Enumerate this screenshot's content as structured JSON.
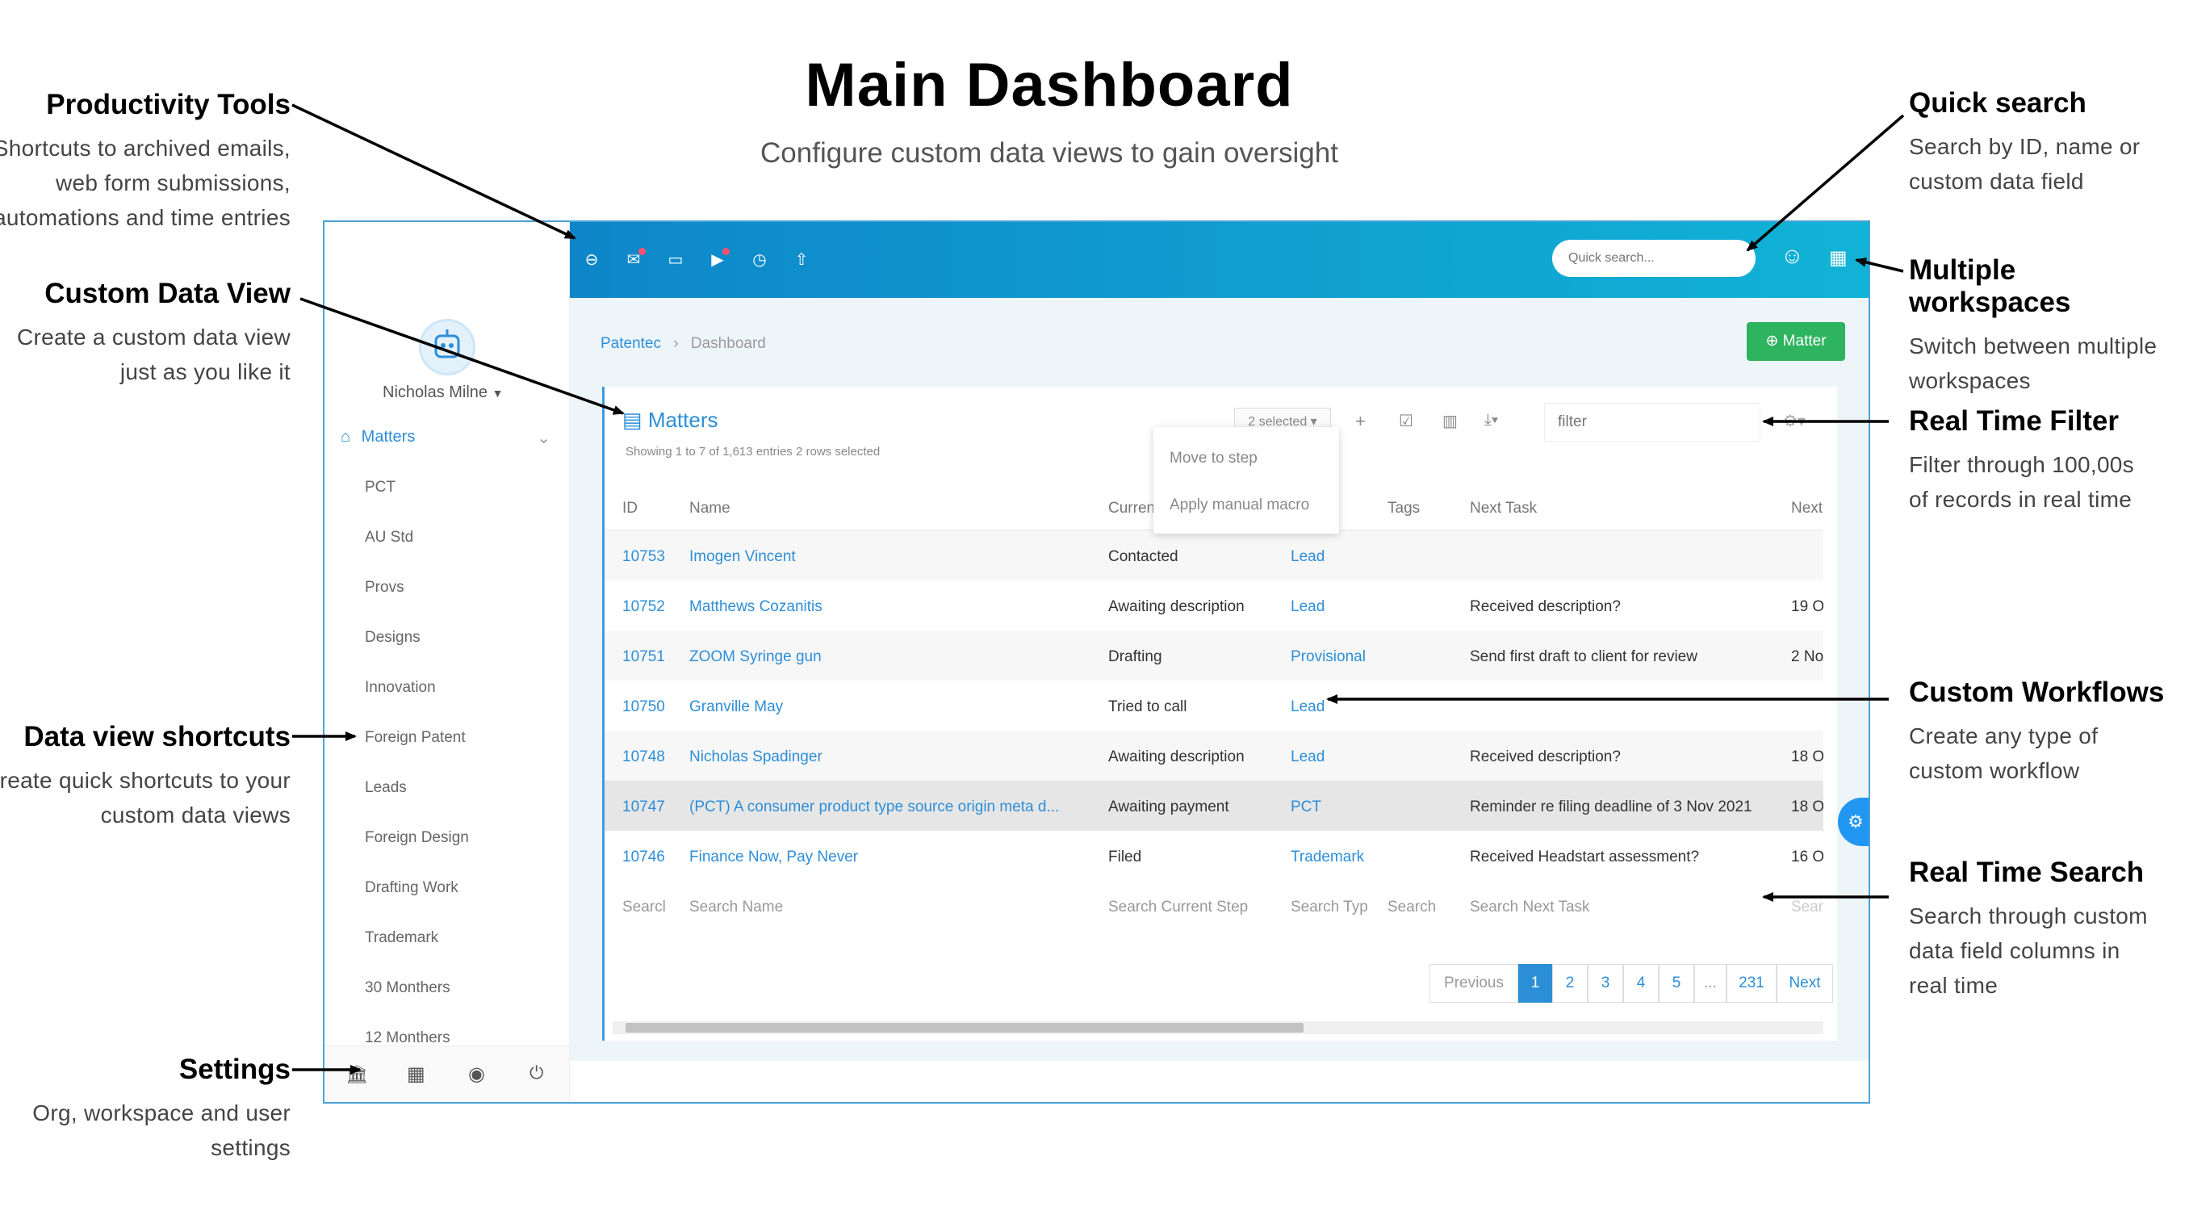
{
  "header": {
    "title": "Main Dashboard",
    "subtitle": "Configure custom data views to gain oversight"
  },
  "annotations": {
    "productivity": {
      "title": "Productivity Tools",
      "lines": [
        "Shortcuts to archived emails,",
        "web form submissions,",
        "automations and time entries"
      ]
    },
    "custom_view": {
      "title": "Custom Data View",
      "lines": [
        "Create a custom data view",
        "just as you like it"
      ]
    },
    "shortcuts": {
      "title": "Data view shortcuts",
      "lines": [
        "Create quick shortcuts to your",
        "custom data views"
      ]
    },
    "settings": {
      "title": "Settings",
      "lines": [
        "Org, workspace and user",
        "settings"
      ]
    },
    "quick_search": {
      "title": "Quick search",
      "lines": [
        "Search by ID, name or",
        "custom data field"
      ]
    },
    "workspaces": {
      "title": "Multiple workspaces",
      "lines": [
        "Switch between multiple",
        "workspaces"
      ]
    },
    "filter": {
      "title": "Real Time Filter",
      "lines": [
        "Filter through 100,00s",
        "of records in real time"
      ]
    },
    "workflows": {
      "title": "Custom Workflows",
      "lines": [
        "Create any type of",
        "custom workflow"
      ]
    },
    "search": {
      "title": "Real Time Search",
      "lines": [
        "Search through custom",
        "data field columns in",
        "real time"
      ]
    }
  },
  "app": {
    "quick_search_placeholder": "Quick search...",
    "user_name": "Nicholas Milne",
    "nav_active": "Matters",
    "nav_items": [
      "PCT",
      "AU Std",
      "Provs",
      "Designs",
      "Innovation",
      "Foreign Patent",
      "Leads",
      "Foreign Design",
      "Drafting Work",
      "Trademark",
      "30 Monthers",
      "12 Monthers"
    ],
    "breadcrumb": [
      "Patentec",
      "Dashboard"
    ],
    "new_matter_button": "Matter",
    "panel_title": "Matters",
    "panel_info": "Showing 1 to 7 of 1,613 entries  2 rows selected",
    "selected_dropdown": "2 selected",
    "filter_placeholder": "filter",
    "dropdown_menu": [
      "Move to step",
      "Apply manual macro"
    ],
    "columns": [
      "ID",
      "Name",
      "Curren",
      "Tags",
      "Next Task",
      "Next"
    ],
    "rows": [
      {
        "id": "10753",
        "name": "Imogen Vincent",
        "step": "Contacted",
        "type": "Lead",
        "task": "",
        "next": ""
      },
      {
        "id": "10752",
        "name": "Matthews Cozanitis",
        "step": "Awaiting description",
        "type": "Lead",
        "task": "Received description?",
        "next": "19 O"
      },
      {
        "id": "10751",
        "name": "ZOOM Syringe gun",
        "step": "Drafting",
        "type": "Provisional",
        "task": "Send first draft to client for review",
        "next": "2 Nov"
      },
      {
        "id": "10750",
        "name": "Granville May",
        "step": "Tried to call",
        "type": "Lead",
        "task": "",
        "next": ""
      },
      {
        "id": "10748",
        "name": "Nicholas Spadinger",
        "step": "Awaiting description",
        "type": "Lead",
        "task": "Received description?",
        "next": "18 Oc"
      },
      {
        "id": "10747",
        "name": "(PCT) A consumer product type source origin meta d...",
        "step": "Awaiting payment",
        "type": "PCT",
        "task": "Reminder re filing deadline of 3 Nov 2021",
        "next": "18 Oc"
      },
      {
        "id": "10746",
        "name": "Finance Now, Pay Never",
        "step": "Filed",
        "type": "Trademark",
        "task": "Received Headstart assessment?",
        "next": "16 Oc"
      }
    ],
    "search_row": [
      "Searcl",
      "Search Name",
      "Search Current Step",
      "Search Typ",
      "Search",
      "Search Next Task",
      "Searc"
    ],
    "pagination": [
      "Previous",
      "1",
      "2",
      "3",
      "4",
      "5",
      "...",
      "231",
      "Next"
    ]
  },
  "colors": {
    "accent": "#2d8ed8",
    "topbar_start": "#0e86c9",
    "topbar_end": "#11b3d6",
    "success": "#2eb35f"
  }
}
